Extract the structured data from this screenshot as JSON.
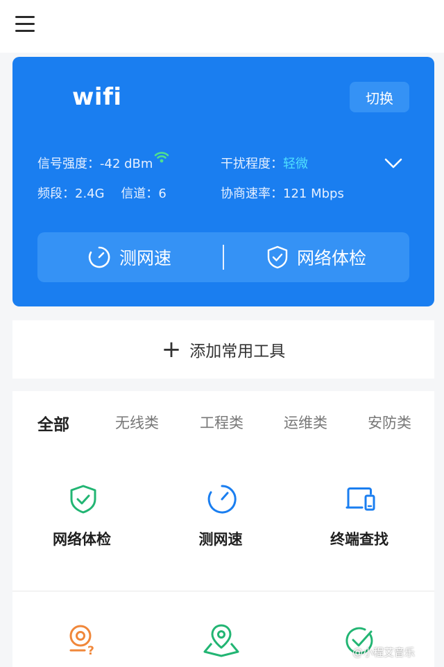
{
  "wifi": {
    "ssid": "wifi",
    "switch_label": "切换",
    "signal_label": "信号强度：",
    "signal_value": "-42 dBm",
    "interference_label": "干扰程度：",
    "interference_value": "轻微",
    "band_label": "频段：",
    "band_value": "2.4G",
    "channel_label": "信道：",
    "channel_value": "6",
    "rate_label": "协商速率：",
    "rate_value": "121 Mbps",
    "actions": {
      "speed_test": "测网速",
      "network_check": "网络体检"
    }
  },
  "add_tools_label": "添加常用工具",
  "tabs": [
    "全部",
    "无线类",
    "工程类",
    "运维类",
    "安防类"
  ],
  "tools": [
    {
      "label": "网络体检",
      "icon": "shield-check-icon"
    },
    {
      "label": "测网速",
      "icon": "speedometer-icon"
    },
    {
      "label": "终端查找",
      "icon": "devices-icon"
    }
  ],
  "watermark": "@小程艾音乐",
  "colors": {
    "card_blue": "#1a7ef0",
    "highlight_cyan": "#4fe0ff",
    "green": "#22b573",
    "blue_icon": "#1a7ef0",
    "orange": "#f0873a"
  }
}
